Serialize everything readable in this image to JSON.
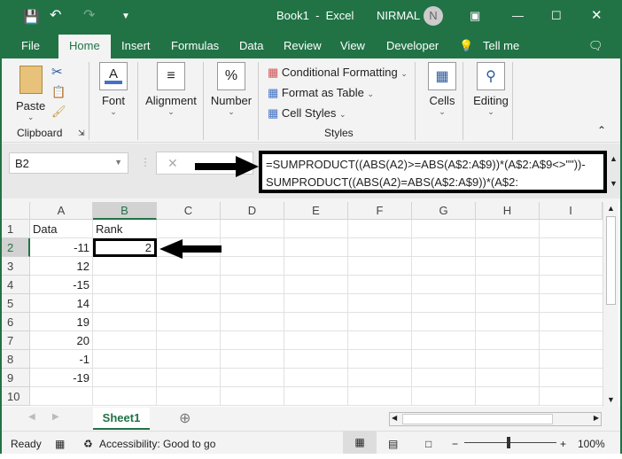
{
  "title_bar": {
    "doc_title": "Book1  -  Excel",
    "user_name": "NIRMAL",
    "avatar_initial": "N"
  },
  "tabs": [
    "File",
    "Home",
    "Insert",
    "Formulas",
    "Data",
    "Review",
    "View",
    "Developer"
  ],
  "tell_me": "Tell me",
  "ribbon": {
    "paste": "Paste",
    "clipboard": "Clipboard",
    "font": "Font",
    "alignment": "Alignment",
    "number": "Number",
    "conditional_formatting": "Conditional Formatting",
    "format_as_table": "Format as Table",
    "cell_styles": "Cell Styles",
    "styles": "Styles",
    "cells": "Cells",
    "editing": "Editing"
  },
  "name_box": "B2",
  "formula": "=SUMPRODUCT((ABS(A2)>=ABS(A$2:A$9))*(A$2:A$9<>\"\"))-SUMPRODUCT((ABS(A2)=ABS(A$2:A$9))*(A$2:",
  "columns": [
    "A",
    "B",
    "C",
    "D",
    "E",
    "F",
    "G",
    "H",
    "I"
  ],
  "rows": [
    {
      "n": "1",
      "a": "Data",
      "b": "Rank"
    },
    {
      "n": "2",
      "a": "-11",
      "b": "2"
    },
    {
      "n": "3",
      "a": "12",
      "b": ""
    },
    {
      "n": "4",
      "a": "-15",
      "b": ""
    },
    {
      "n": "5",
      "a": "14",
      "b": ""
    },
    {
      "n": "6",
      "a": "19",
      "b": ""
    },
    {
      "n": "7",
      "a": "20",
      "b": ""
    },
    {
      "n": "8",
      "a": "-1",
      "b": ""
    },
    {
      "n": "9",
      "a": "-19",
      "b": ""
    },
    {
      "n": "10",
      "a": "",
      "b": ""
    }
  ],
  "sheet_tab": "Sheet1",
  "status": {
    "ready": "Ready",
    "accessibility": "Accessibility: Good to go",
    "zoom": "100%"
  },
  "colors": {
    "accent": "#217346"
  }
}
